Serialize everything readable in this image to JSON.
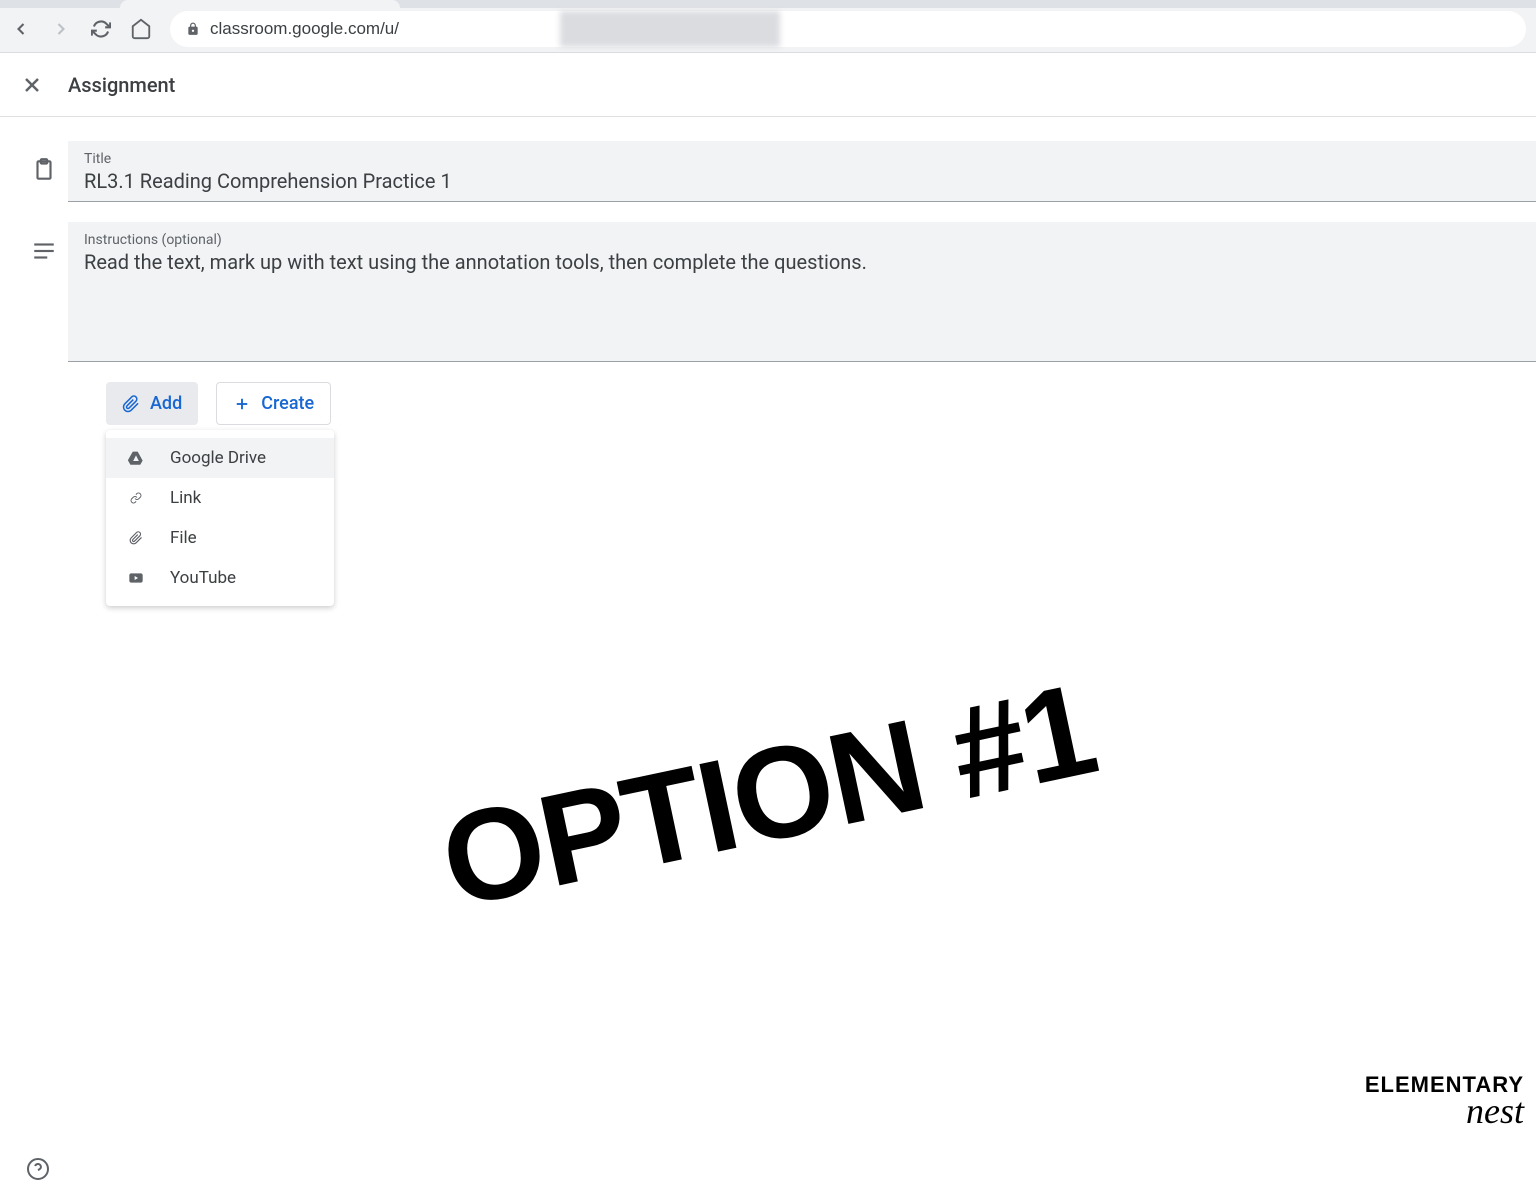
{
  "browser": {
    "url": "classroom.google.com/u/"
  },
  "header": {
    "title": "Assignment"
  },
  "form": {
    "title_label": "Title",
    "title_value": "RL3.1 Reading Comprehension Practice 1",
    "instructions_label": "Instructions (optional)",
    "instructions_value": "Read the text, mark up with text using the annotation tools, then complete the questions."
  },
  "buttons": {
    "add": "Add",
    "create": "Create"
  },
  "dropdown": {
    "items": [
      {
        "label": "Google Drive",
        "icon": "drive"
      },
      {
        "label": "Link",
        "icon": "link"
      },
      {
        "label": "File",
        "icon": "file"
      },
      {
        "label": "YouTube",
        "icon": "youtube"
      }
    ]
  },
  "overlay": {
    "text": "OPTION #1"
  },
  "watermark": {
    "line1": "ELEMENTARY",
    "line2": "nest"
  }
}
